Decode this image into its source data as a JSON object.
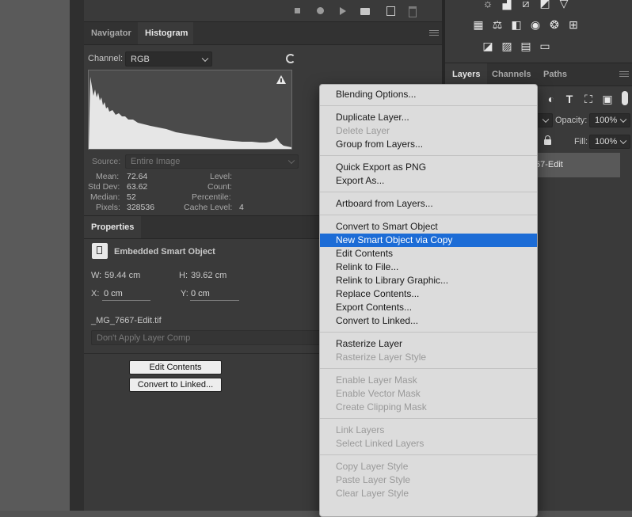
{
  "navigator_panel": {
    "tabs": [
      {
        "label": "Navigator",
        "active": false
      },
      {
        "label": "Histogram",
        "active": true
      }
    ],
    "channel_label": "Channel:",
    "channel_value": "RGB",
    "warning_icon": "warning-triangle-icon",
    "source_label": "Source:",
    "source_value": "Entire Image",
    "stats_left": [
      {
        "label": "Mean:",
        "value": "72.64"
      },
      {
        "label": "Std Dev:",
        "value": "63.62"
      },
      {
        "label": "Median:",
        "value": "52"
      },
      {
        "label": "Pixels:",
        "value": "328536"
      }
    ],
    "stats_right": [
      {
        "label": "Level:",
        "value": ""
      },
      {
        "label": "Count:",
        "value": ""
      },
      {
        "label": "Percentile:",
        "value": ""
      },
      {
        "label": "Cache Level:",
        "value": "4"
      }
    ]
  },
  "properties_panel": {
    "tab_label": "Properties",
    "object_type": "Embedded Smart Object",
    "w_label": "W:",
    "w_value": "59.44 cm",
    "h_label": "H:",
    "h_value": "39.62 cm",
    "x_label": "X:",
    "x_value": "0 cm",
    "y_label": "Y:",
    "y_value": "0 cm",
    "filename": "_MG_7667-Edit.tif",
    "layer_comp_value": "Don't Apply Layer Comp",
    "edit_contents_button": "Edit Contents",
    "convert_linked_button": "Convert to Linked..."
  },
  "layers_panel": {
    "tabs": [
      {
        "label": "Layers",
        "active": true
      },
      {
        "label": "Channels",
        "active": false
      },
      {
        "label": "Paths",
        "active": false
      }
    ],
    "opacity_label": "Opacity:",
    "opacity_value": "100%",
    "fill_label": "Fill:",
    "fill_value": "100%",
    "layer_name_partial": "67-Edit"
  },
  "context_menu": {
    "groups": [
      [
        {
          "label": "Blending Options...",
          "enabled": true
        }
      ],
      [
        {
          "label": "Duplicate Layer...",
          "enabled": true
        },
        {
          "label": "Delete Layer",
          "enabled": false
        },
        {
          "label": "Group from Layers...",
          "enabled": true
        }
      ],
      [
        {
          "label": "Quick Export as PNG",
          "enabled": true
        },
        {
          "label": "Export As...",
          "enabled": true
        }
      ],
      [
        {
          "label": "Artboard from Layers...",
          "enabled": true
        }
      ],
      [
        {
          "label": "Convert to Smart Object",
          "enabled": true
        },
        {
          "label": "New Smart Object via Copy",
          "enabled": true,
          "highlighted": true
        },
        {
          "label": "Edit Contents",
          "enabled": true
        },
        {
          "label": "Relink to File...",
          "enabled": true
        },
        {
          "label": "Relink to Library Graphic...",
          "enabled": true
        },
        {
          "label": "Replace Contents...",
          "enabled": true
        },
        {
          "label": "Export Contents...",
          "enabled": true
        },
        {
          "label": "Convert to Linked...",
          "enabled": true
        }
      ],
      [
        {
          "label": "Rasterize Layer",
          "enabled": true
        },
        {
          "label": "Rasterize Layer Style",
          "enabled": false
        }
      ],
      [
        {
          "label": "Enable Layer Mask",
          "enabled": false
        },
        {
          "label": "Enable Vector Mask",
          "enabled": false
        },
        {
          "label": "Create Clipping Mask",
          "enabled": false
        }
      ],
      [
        {
          "label": "Link Layers",
          "enabled": false
        },
        {
          "label": "Select Linked Layers",
          "enabled": false
        }
      ],
      [
        {
          "label": "Copy Layer Style",
          "enabled": false
        },
        {
          "label": "Paste Layer Style",
          "enabled": false
        },
        {
          "label": "Clear Layer Style",
          "enabled": false
        }
      ]
    ]
  },
  "colors": {
    "highlight": "#1c6cd6",
    "menu_bg": "#dcdcdc",
    "panel_bg": "#3a3a3a"
  }
}
